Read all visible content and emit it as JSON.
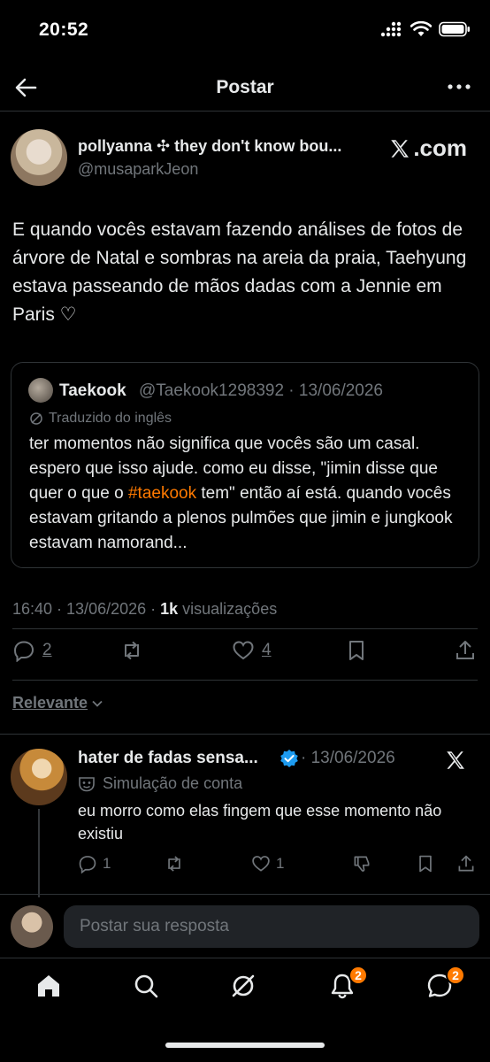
{
  "status_bar": {
    "time": "20:52"
  },
  "header": {
    "title": "Postar"
  },
  "post": {
    "author_name": "pollyanna ✣ they don't know bou...",
    "author_handle": "@musaparkJeon",
    "brand": ".com",
    "text": "E quando vocês estavam fazendo análises de fotos de árvore de Natal e sombras na areia da praia, Taehyung estava passeando de mãos dadas com a Jennie em Paris ♡",
    "timestamp": "16:40 · 13/06/2026 · ",
    "views_count": "1k",
    "views_label": " visualizações",
    "replies": "2",
    "likes": "4"
  },
  "quote": {
    "name": "Taekook",
    "meta": "@Taekook1298392 · 13/06/2026",
    "translated_label": "Traduzido do inglês",
    "text_before": "ter momentos não significa que vocês são um casal. espero que isso ajude. como eu disse, \"jimin disse que quer o que o ",
    "hashtag": "#taekook",
    "text_after": " tem\" então aí está. quando vocês estavam gritando a plenos pulmões que jimin e jungkook estavam namorand..."
  },
  "sort": {
    "label": "Relevante"
  },
  "reply": {
    "name": "hater de fadas sensa...",
    "meta": "· 13/06/2026",
    "label": "Simulação de conta",
    "text": "eu morro como elas fingem que esse momento não existiu",
    "replies": "1",
    "likes": "1"
  },
  "composer": {
    "placeholder": "Postar sua resposta"
  },
  "nav": {
    "notifications_badge": "2",
    "messages_badge": "2"
  },
  "colors": {
    "accent": "#ff7a00",
    "verified": "#1d9bf0",
    "muted": "#71767b"
  }
}
